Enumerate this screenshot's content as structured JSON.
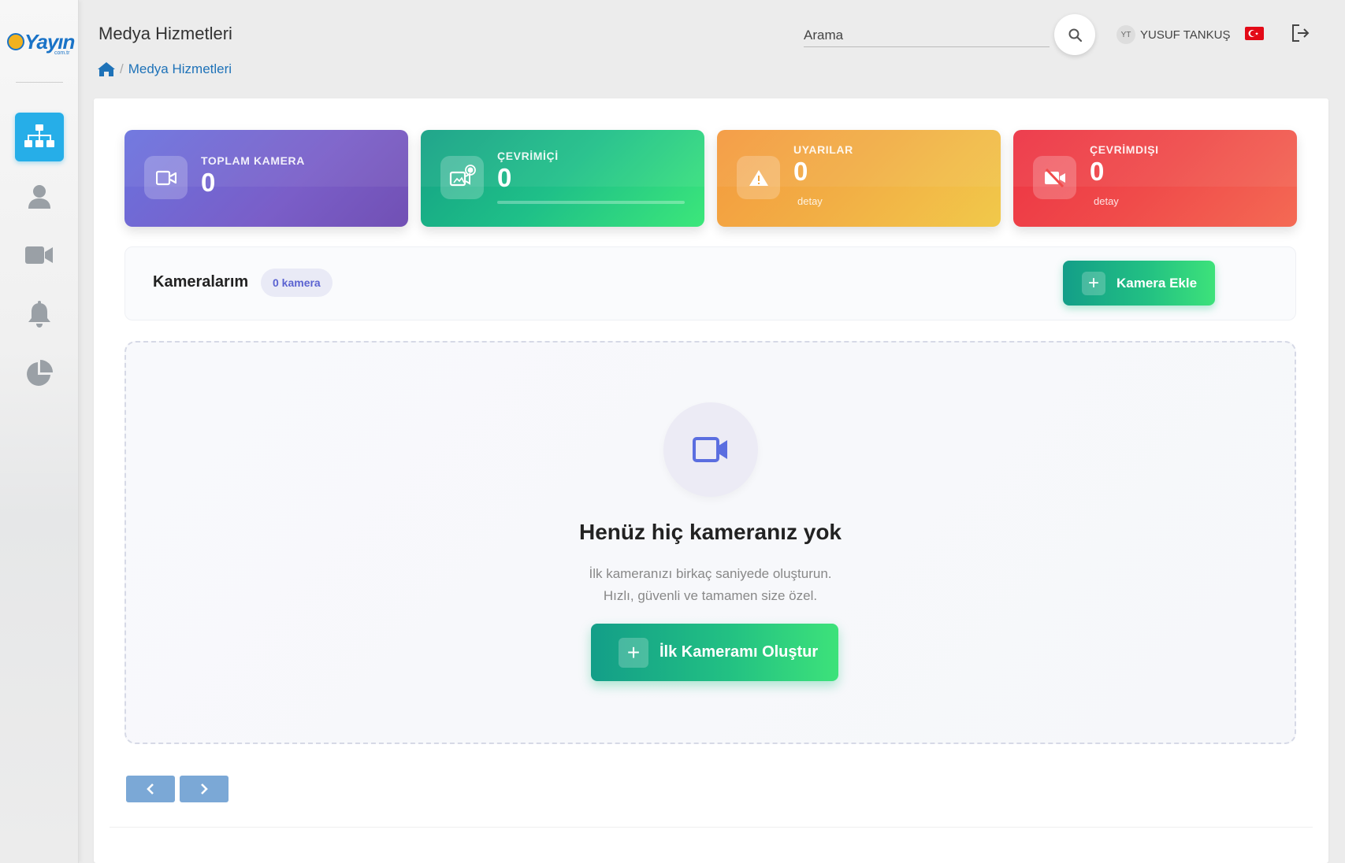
{
  "header": {
    "title": "Medya Hizmetleri",
    "breadcrumb": {
      "current": "Medya Hizmetleri"
    },
    "search": {
      "placeholder": "Arama"
    },
    "user": {
      "initials": "YT",
      "name": "YUSUF TANKUŞ"
    },
    "language_flag": "turkey-flag"
  },
  "logo": {
    "text": "Yayın",
    "subtext": "com.tr"
  },
  "sidebar": {
    "items": [
      {
        "icon": "sitemap-icon",
        "active": true
      },
      {
        "icon": "user-icon",
        "active": false
      },
      {
        "icon": "video-camera-icon",
        "active": false
      },
      {
        "icon": "bell-icon",
        "active": false
      },
      {
        "icon": "pie-chart-icon",
        "active": false
      }
    ]
  },
  "stats": [
    {
      "label": "TOPLAM KAMERA",
      "value": "0",
      "color": "#7563d0",
      "icon": "video-camera-icon"
    },
    {
      "label": "ÇEVRİMİÇİ",
      "value": "0",
      "color": "#1fc088",
      "icon": "camera-online-icon",
      "progress": 0
    },
    {
      "label": "UYARILAR",
      "value": "0",
      "sub": "detay",
      "color": "#f2af45",
      "icon": "warning-icon"
    },
    {
      "label": "ÇEVRİMDIŞI",
      "value": "0",
      "sub": "detay",
      "color": "#f04b4a",
      "icon": "video-camera-off-icon"
    }
  ],
  "cameras": {
    "title": "Kameralarım",
    "count_badge": "0 kamera",
    "add_button": "Kamera Ekle"
  },
  "empty_state": {
    "title": "Henüz hiç kameranız yok",
    "desc_line1": "İlk kameranızı birkaç saniyede oluşturun.",
    "desc_line2": "Hızlı, güvenli ve tamamen size özel.",
    "button": "İlk Kameramı Oluştur"
  },
  "pagination": {
    "prev_icon": "chevron-left-icon",
    "next_icon": "chevron-right-icon"
  },
  "colors": {
    "accent_blue": "#26aee8",
    "link_blue": "#1e72b8",
    "green": "#22c083"
  }
}
